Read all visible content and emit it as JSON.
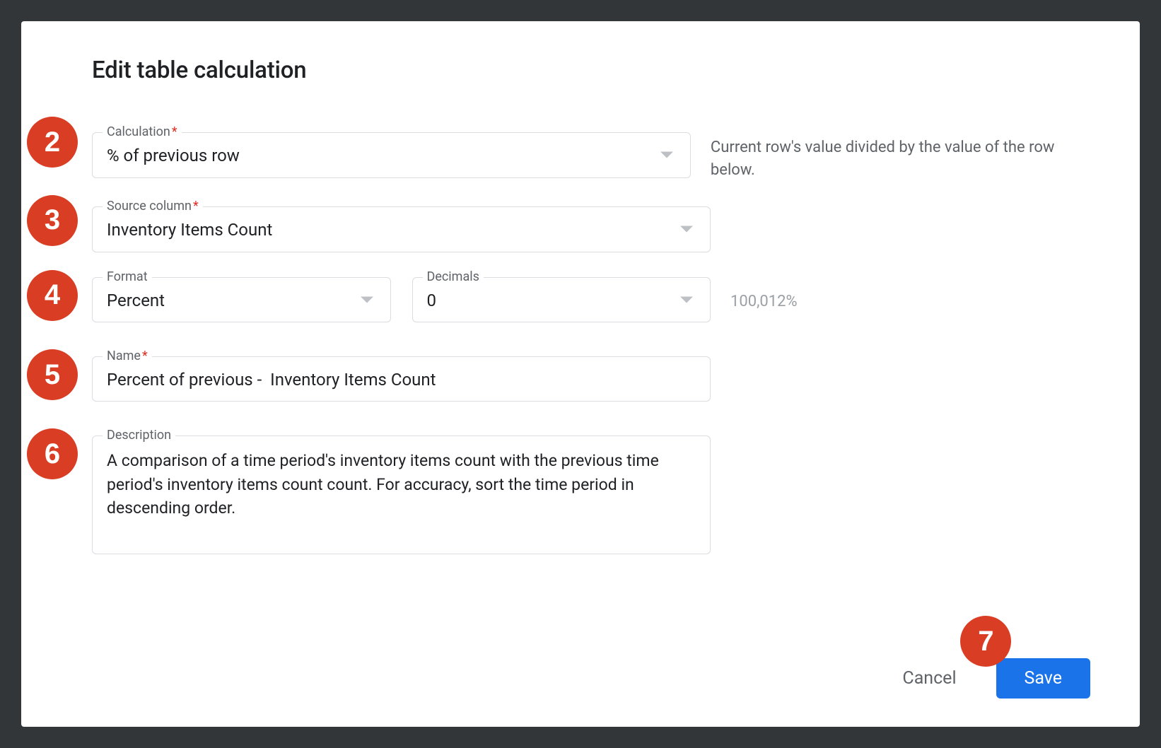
{
  "dialog": {
    "title": "Edit table calculation"
  },
  "fields": {
    "calculation": {
      "label": "Calculation",
      "required": "*",
      "value": "% of previous row",
      "hint": "Current row's value divided by the value of the row below."
    },
    "source_column": {
      "label": "Source column",
      "required": "*",
      "value": "Inventory Items Count"
    },
    "format": {
      "label": "Format",
      "value": "Percent"
    },
    "decimals": {
      "label": "Decimals",
      "value": "0"
    },
    "format_preview": "100,012%",
    "name": {
      "label": "Name",
      "required": "*",
      "value": "Percent of previous -  Inventory Items Count"
    },
    "description": {
      "label": "Description",
      "value": "A comparison of a time period's inventory items count with the previous time period's inventory items count count. For accuracy, sort the time period in descending order."
    }
  },
  "actions": {
    "cancel": "Cancel",
    "save": "Save"
  },
  "annotations": {
    "b2": "2",
    "b3": "3",
    "b4": "4",
    "b5": "5",
    "b6": "6",
    "b7": "7"
  }
}
